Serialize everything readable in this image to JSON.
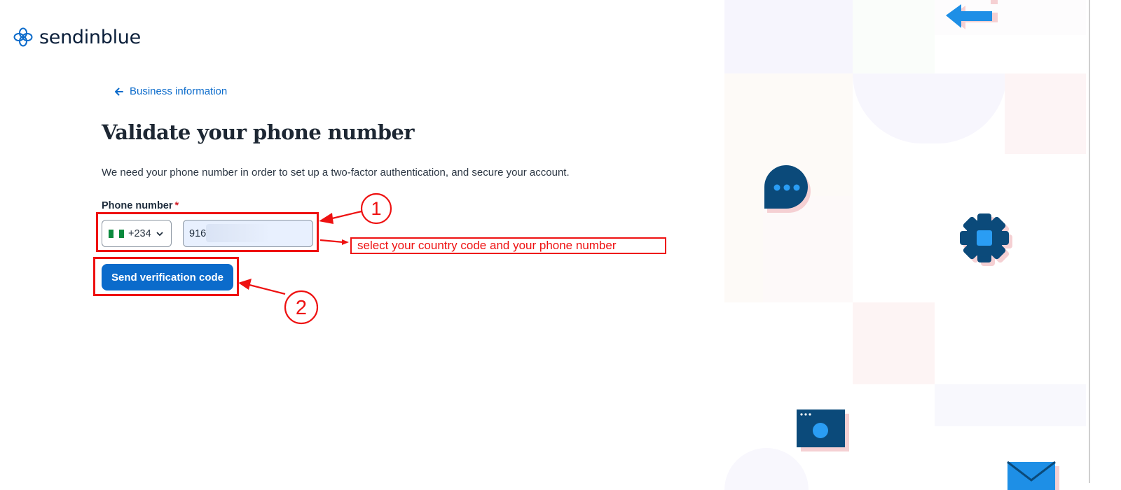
{
  "brand": {
    "name": "sendinblue"
  },
  "nav": {
    "back_label": "Business information"
  },
  "main": {
    "title": "Validate your phone number",
    "description": "We need your phone number in order to set up a two-factor authentication, and secure your account.",
    "phone_label": "Phone number",
    "required_mark": "*",
    "country_code": "+234",
    "phone_value": "916",
    "send_button": "Send verification code"
  },
  "annotations": {
    "step1": "1",
    "step2": "2",
    "note": "select your country code and your phone number"
  },
  "icons": [
    "sendinblue-logo-icon",
    "arrow-left-icon",
    "nigeria-flag-icon",
    "chevron-down-icon",
    "chat-bubble-icon",
    "gear-icon",
    "browser-window-icon",
    "envelope-icon",
    "swap-arrows-icon"
  ],
  "colors": {
    "accent": "#0b6bcb",
    "annotation": "#ee1111",
    "navy": "#0b4a7a"
  }
}
